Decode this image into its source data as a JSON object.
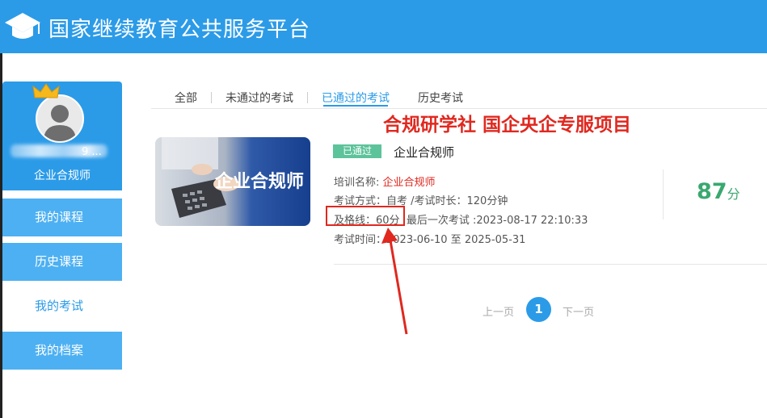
{
  "header": {
    "title": "国家继续教育公共服务平台",
    "logo_icon": "graduation-cap-icon",
    "bg_color": "#2b9be8"
  },
  "sidebar": {
    "profile": {
      "username_suffix": "9 ...",
      "role": "企业合规师",
      "avatar_icon": "user-avatar-icon",
      "crown_icon": "crown-icon"
    },
    "items": [
      {
        "label": "我的课程",
        "active": false
      },
      {
        "label": "历史课程",
        "active": false
      },
      {
        "label": "我的考试",
        "active": true
      },
      {
        "label": "我的档案",
        "active": false
      }
    ]
  },
  "tabs": [
    {
      "label": "全部",
      "active": false
    },
    {
      "label": "未通过的考试",
      "active": false
    },
    {
      "label": "已通过的考试",
      "active": true
    },
    {
      "label": "历史考试",
      "active": false
    }
  ],
  "watermark": "合规研学社 国企央企专服项目",
  "exam": {
    "thumbnail_title": "企业合规师",
    "status_badge": "已通过",
    "name": "企业合规师",
    "training_label": "培训名称:",
    "training_value": "企业合规师",
    "method": "考试方式：自考 /考试时长：120分钟",
    "pass_line": "及格线：60分",
    "last_exam": "最后一次考试 :2023-08-17 22:10:33",
    "period": "考试时间：2023-06-10 至 2025-05-31",
    "score": "87",
    "score_unit": "分"
  },
  "pagination": {
    "prev": "上一页",
    "current": "1",
    "next": "下一页"
  },
  "colors": {
    "accent": "#2b9be8",
    "pass_green": "#5cc39a",
    "score_green": "#3aa86f",
    "annotation_red": "#e0281f"
  }
}
